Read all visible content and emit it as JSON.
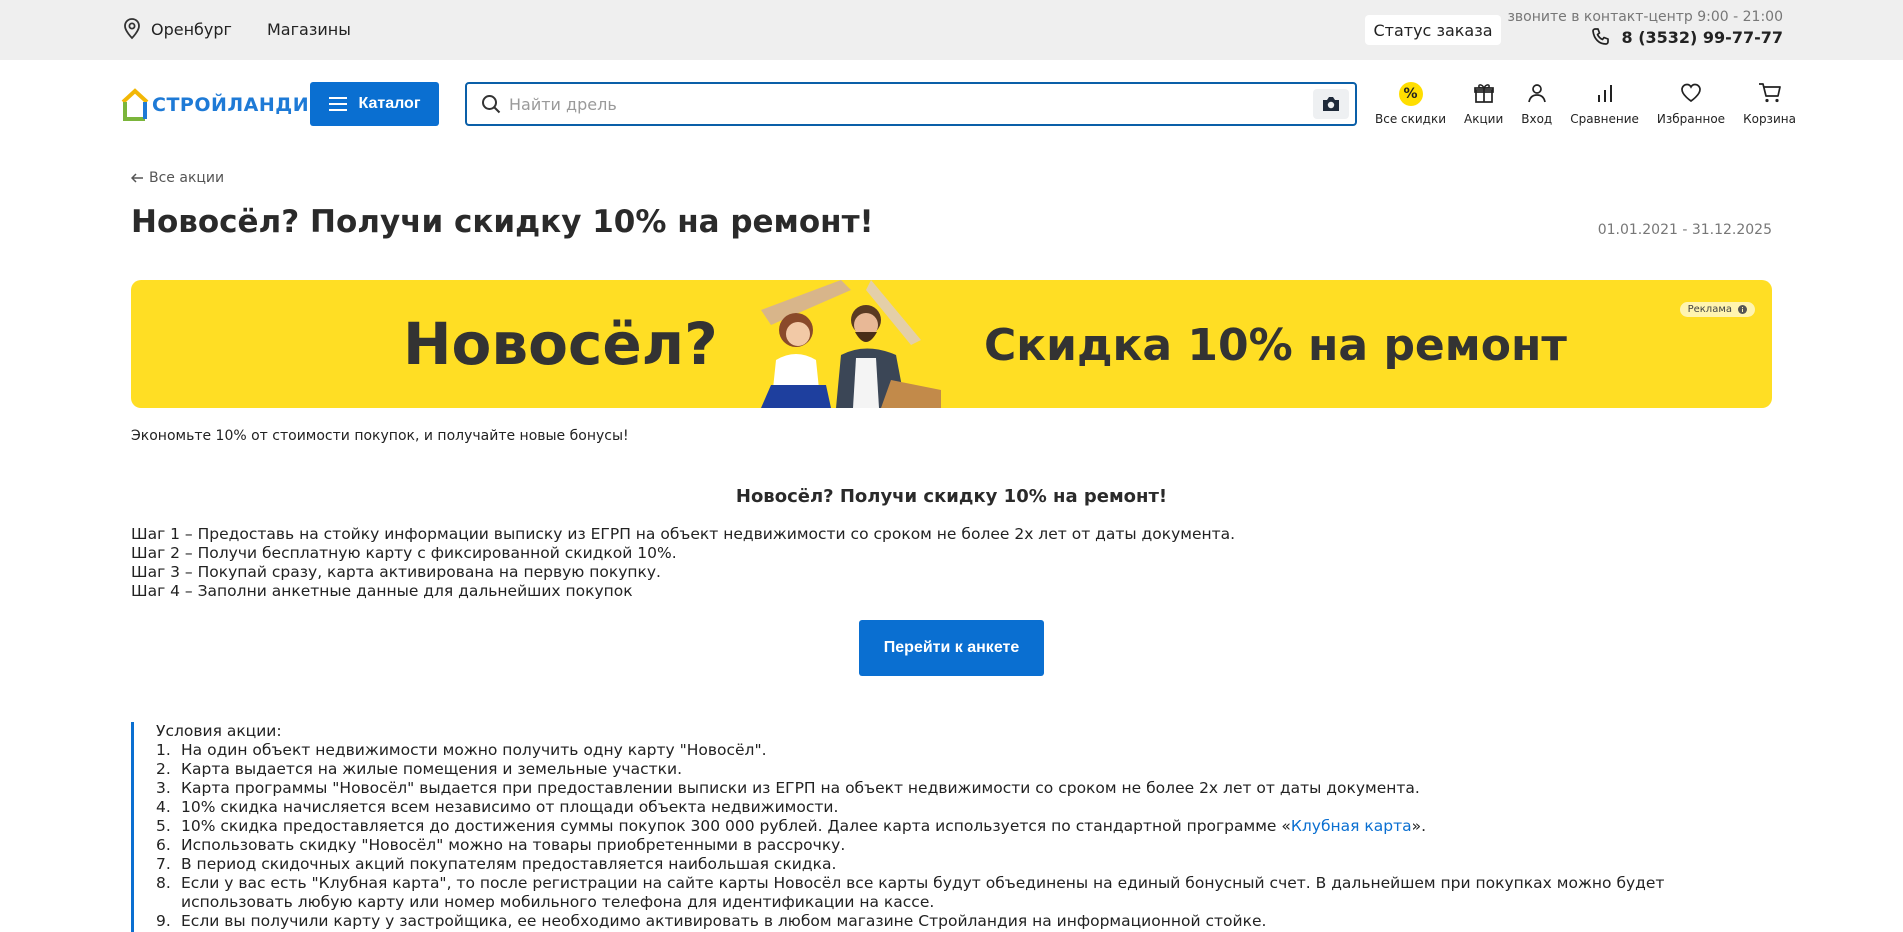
{
  "topbar": {
    "city": "Оренбург",
    "shops": "Магазины",
    "order_status": "Статус заказа",
    "call_hint": "звоните в контакт-центр 9:00 - 21:00",
    "phone": "8 (3532) 99-77-77"
  },
  "header": {
    "logo_text": "СТРОЙЛАНДИЯ",
    "catalog_label": "Каталог",
    "search_placeholder": "Найти дрель",
    "icons": [
      {
        "label": "Все скидки",
        "icon": "percent-icon"
      },
      {
        "label": "Акции",
        "icon": "gift-icon"
      },
      {
        "label": "Вход",
        "icon": "user-icon"
      },
      {
        "label": "Сравнение",
        "icon": "compare-icon"
      },
      {
        "label": "Избранное",
        "icon": "heart-icon"
      },
      {
        "label": "Корзина",
        "icon": "cart-icon"
      }
    ]
  },
  "page": {
    "back_label": "Все акции",
    "title": "Новосёл? Получи скидку 10% на ремонт!",
    "dates": "01.01.2021 - 31.12.2025"
  },
  "banner": {
    "left_text": "Новосёл?",
    "right_text": "Скидка 10% на ремонт",
    "ad_label": "Реклама",
    "bg_color": "#ffde24"
  },
  "intro": {
    "note": "Экономьте 10% от стоимости покупок, и получайте новые бонусы!",
    "section_title": "Новосёл? Получи скидку 10% на ремонт!",
    "steps": [
      "Шаг 1 – Предоставь на стойку информации выписку из ЕГРП на объект недвижимости со сроком не более 2х лет от даты документа.",
      "Шаг 2 – Получи бесплатную карту с фиксированной скидкой 10%.",
      "Шаг 3 – Покупай сразу, карта активирована на первую покупку.",
      "Шаг 4 – Заполни анкетные данные для дальнейших покупок"
    ],
    "cta_label": "Перейти к анкете"
  },
  "conditions": {
    "heading": "Условия акции:",
    "items": [
      {
        "num": "1.",
        "text": "На один объект недвижимости можно получить одну карту \"Новосёл\"."
      },
      {
        "num": "2.",
        "text": "Карта выдается на жилые помещения и земельные участки."
      },
      {
        "num": "3.",
        "text": "Карта программы \"Новосёл\"  выдается при предоставлении выписки из ЕГРП на объект недвижимости со сроком не более 2х лет от даты документа."
      },
      {
        "num": "4.",
        "text": "10% скидка начисляется всем независимо от площади объекта недвижимости."
      },
      {
        "num": "5.",
        "text_before": "10% скидка предоставляется до достижения суммы покупок 300 000 рублей. Далее карта используется по стандартной программе «",
        "link": "Клубная карта",
        "text_after": "»."
      },
      {
        "num": "6.",
        "text": "Использовать скидку \"Новосёл\" можно на товары приобретенными в рассрочку."
      },
      {
        "num": "7.",
        "text": "В период скидочных акций покупателям предоставляется наибольшая скидка."
      },
      {
        "num": "8.",
        "text": "Если у вас есть \"Клубная карта\", то после регистрации на сайте карты Новосёл все карты будут объединены на единый бонусный счет. В дальнейшем при покупках можно будет использовать любую карту или номер мобильного телефона для идентификации на кассе."
      },
      {
        "num": "9.",
        "text": "Если вы получили карту у застройщика, ее необходимо активировать в любом магазине Стройландия на информационной стойке."
      }
    ]
  },
  "colors": {
    "accent": "#0a6fd1",
    "topbar_bg": "#efefef",
    "badge_yellow": "#ffde00"
  }
}
